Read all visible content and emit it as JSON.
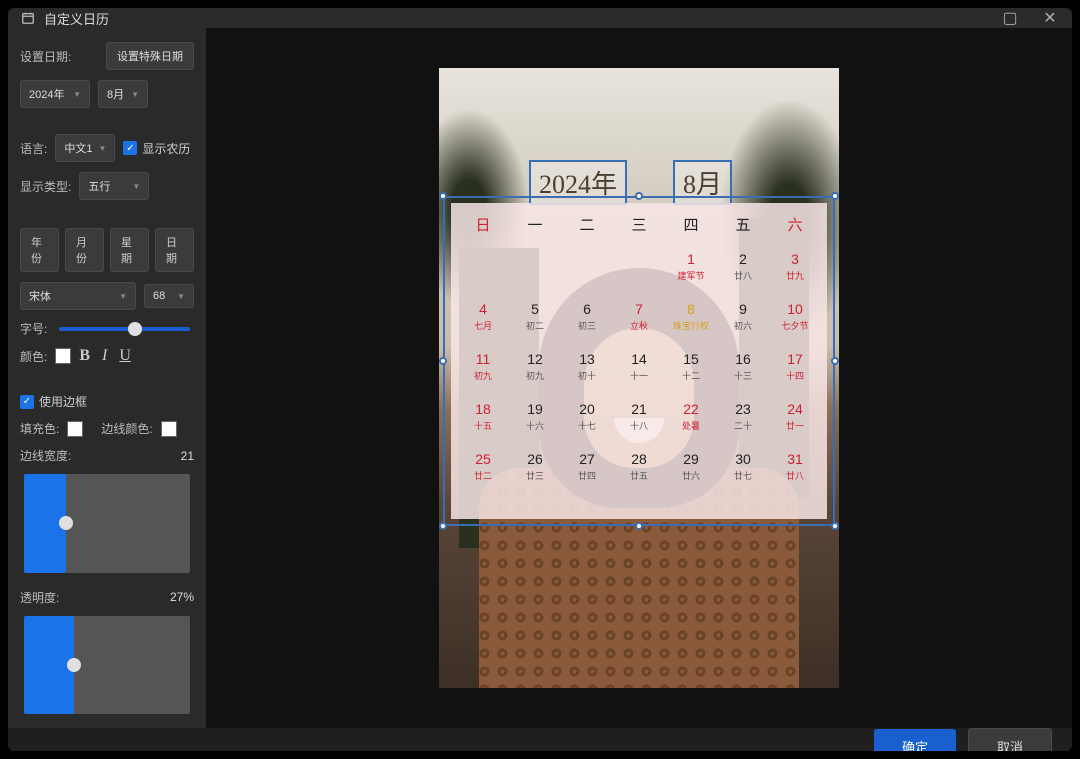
{
  "title": "自定义日历",
  "sidebar": {
    "set_date_label": "设置日期:",
    "special_btn": "设置特殊日期",
    "year_select": "2024年",
    "month_select": "8月",
    "lang_label": "语言:",
    "lang_select": "中文1",
    "show_lunar": "显示农历",
    "display_type_label": "显示类型:",
    "display_type_select": "五行",
    "tabs": [
      "年份",
      "月份",
      "星期",
      "日期"
    ],
    "font_select": "宋体",
    "fontsize_select": "68",
    "fontsize_label": "字号:",
    "color_label": "颜色:",
    "use_border": "使用边框",
    "fill_label": "填充色:",
    "border_color_label": "边线颜色:",
    "border_width_label": "边线宽度:",
    "border_width_val": "21",
    "opacity_label": "透明度:",
    "opacity_val": "27%"
  },
  "preview": {
    "year": "2024年",
    "month": "8月",
    "weekdays": [
      "日",
      "一",
      "二",
      "三",
      "四",
      "五",
      "六"
    ],
    "weeks": [
      [
        null,
        null,
        null,
        null,
        {
          "n": "1",
          "c": "red",
          "s": "建军节",
          "sc": "red"
        },
        {
          "n": "2",
          "s": "廿八"
        },
        {
          "n": "3",
          "c": "red",
          "s": "廿九",
          "sc": "red"
        }
      ],
      [
        {
          "n": "4",
          "c": "red",
          "s": "七月",
          "sc": "red"
        },
        {
          "n": "5",
          "s": "初二"
        },
        {
          "n": "6",
          "s": "初三"
        },
        {
          "n": "7",
          "c": "red",
          "s": "立秋",
          "sc": "red"
        },
        {
          "n": "8",
          "c": "yellow",
          "s": "珠宝行权",
          "sc": "yellow"
        },
        {
          "n": "9",
          "s": "初六"
        },
        {
          "n": "10",
          "c": "red",
          "s": "七夕节",
          "sc": "red"
        }
      ],
      [
        {
          "n": "11",
          "c": "red",
          "s": "初九",
          "sc": "red"
        },
        {
          "n": "12",
          "s": "初九"
        },
        {
          "n": "13",
          "s": "初十"
        },
        {
          "n": "14",
          "s": "十一"
        },
        {
          "n": "15",
          "s": "十二"
        },
        {
          "n": "16",
          "s": "十三"
        },
        {
          "n": "17",
          "c": "red",
          "s": "十四",
          "sc": "red"
        }
      ],
      [
        {
          "n": "18",
          "c": "red",
          "s": "十五",
          "sc": "red"
        },
        {
          "n": "19",
          "s": "十六"
        },
        {
          "n": "20",
          "s": "十七"
        },
        {
          "n": "21",
          "s": "十八"
        },
        {
          "n": "22",
          "c": "red",
          "s": "处暑",
          "sc": "red"
        },
        {
          "n": "23",
          "s": "二十"
        },
        {
          "n": "24",
          "c": "red",
          "s": "廿一",
          "sc": "red"
        }
      ],
      [
        {
          "n": "25",
          "c": "red",
          "s": "廿二",
          "sc": "red"
        },
        {
          "n": "26",
          "s": "廿三"
        },
        {
          "n": "27",
          "s": "廿四"
        },
        {
          "n": "28",
          "s": "廿五"
        },
        {
          "n": "29",
          "s": "廿六"
        },
        {
          "n": "30",
          "s": "廿七"
        },
        {
          "n": "31",
          "c": "red",
          "s": "廿八",
          "sc": "red"
        }
      ]
    ]
  },
  "footer": {
    "ok": "确定",
    "cancel": "取消"
  }
}
